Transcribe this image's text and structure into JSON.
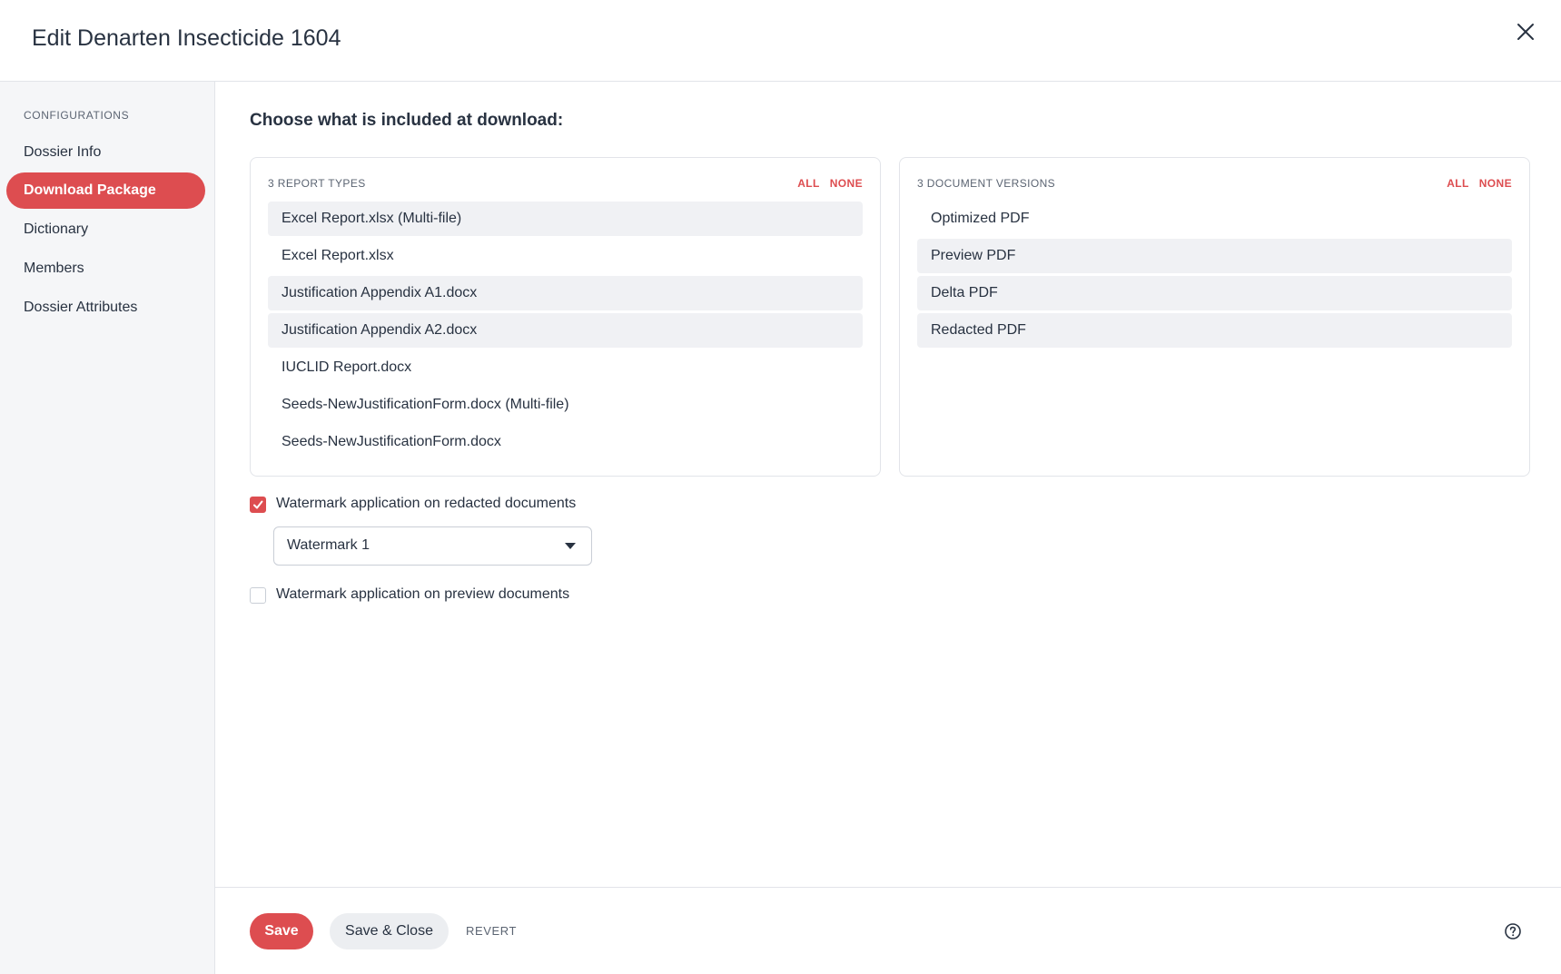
{
  "header": {
    "title": "Edit Denarten Insecticide 1604",
    "close_icon": "close-icon"
  },
  "sidebar": {
    "heading": "CONFIGURATIONS",
    "items": [
      {
        "label": "Dossier Info",
        "active": false
      },
      {
        "label": "Download Package",
        "active": true
      },
      {
        "label": "Dictionary",
        "active": false
      },
      {
        "label": "Members",
        "active": false
      },
      {
        "label": "Dossier Attributes",
        "active": false
      }
    ]
  },
  "main": {
    "section_title": "Choose what is included at download:",
    "report_types": {
      "count_label": "3 REPORT TYPES",
      "all_label": "ALL",
      "none_label": "NONE",
      "items": [
        {
          "label": "Excel Report.xlsx (Multi-file)",
          "selected": true
        },
        {
          "label": "Excel Report.xlsx",
          "selected": false
        },
        {
          "label": "Justification Appendix A1.docx",
          "selected": true
        },
        {
          "label": "Justification Appendix A2.docx",
          "selected": true
        },
        {
          "label": "IUCLID Report.docx",
          "selected": false
        },
        {
          "label": "Seeds-NewJustificationForm.docx (Multi-file)",
          "selected": false
        },
        {
          "label": "Seeds-NewJustificationForm.docx",
          "selected": false
        }
      ]
    },
    "document_versions": {
      "count_label": "3 DOCUMENT VERSIONS",
      "all_label": "ALL",
      "none_label": "NONE",
      "items": [
        {
          "label": "Optimized PDF",
          "selected": false
        },
        {
          "label": "Preview PDF",
          "selected": true
        },
        {
          "label": "Delta PDF",
          "selected": true
        },
        {
          "label": "Redacted PDF",
          "selected": true
        }
      ]
    },
    "watermark_redacted": {
      "label": "Watermark application on redacted documents",
      "checked": true,
      "selected_watermark": "Watermark 1"
    },
    "watermark_preview": {
      "label": "Watermark application on preview documents",
      "checked": false
    }
  },
  "footer": {
    "save_label": "Save",
    "save_close_label": "Save & Close",
    "revert_label": "REVERT",
    "help_icon": "help-icon"
  },
  "colors": {
    "accent": "#dd4d50",
    "selected_row": "#f0f1f4",
    "sidebar_bg": "#f5f6f8",
    "text": "#283241"
  }
}
